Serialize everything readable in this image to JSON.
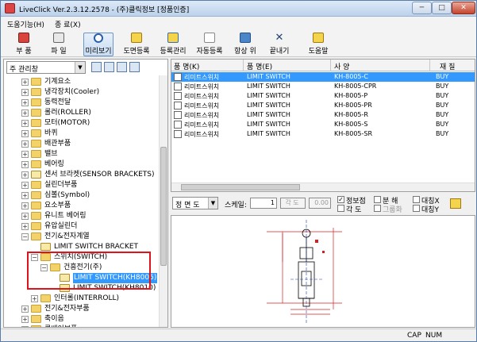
{
  "window": {
    "title": "LiveClick Ver.2.3.12.2578 - (주)클릭정보 [정품인증]",
    "min": "─",
    "max": "□",
    "close": "✕"
  },
  "menu": [
    "도움기능(H)",
    "종 료(X)"
  ],
  "toolbar": [
    {
      "label": "부 품",
      "icon": "parts-icon"
    },
    {
      "label": "파 일",
      "icon": "file-icon"
    },
    {
      "label": "미리보기",
      "icon": "preview-icon"
    },
    {
      "label": "도면등록",
      "icon": "drawing-register-icon"
    },
    {
      "label": "등록관리",
      "icon": "register-manage-icon"
    },
    {
      "label": "자동등록",
      "icon": "auto-register-icon"
    },
    {
      "label": "항상 위",
      "icon": "always-on-top-icon"
    },
    {
      "label": "끝내기",
      "icon": "exit-icon"
    },
    {
      "label": "도움말",
      "icon": "help-icon"
    }
  ],
  "left_panel": {
    "combo_value": "주 관리창",
    "combo_arrow": "▼",
    "tree": [
      {
        "label": "기계요소",
        "level": 1,
        "expander": "+"
      },
      {
        "label": "냉각장치(Cooler)",
        "level": 1,
        "expander": "+"
      },
      {
        "label": "동력전달",
        "level": 1,
        "expander": "+"
      },
      {
        "label": "롤러(ROLLER)",
        "level": 1,
        "expander": "+"
      },
      {
        "label": "모터(MOTOR)",
        "level": 1,
        "expander": "+"
      },
      {
        "label": "바퀴",
        "level": 1,
        "expander": "+"
      },
      {
        "label": "배관부품",
        "level": 1,
        "expander": "+"
      },
      {
        "label": "밸브",
        "level": 1,
        "expander": "+"
      },
      {
        "label": "베어링",
        "level": 1,
        "expander": "+"
      },
      {
        "label": "센서 브라켓(SENSOR BRACKETS)",
        "level": 1,
        "expander": "+"
      },
      {
        "label": "실린더부품",
        "level": 1,
        "expander": "+"
      },
      {
        "label": "심볼(Symbol)",
        "level": 1,
        "expander": "+"
      },
      {
        "label": "요소부품",
        "level": 1,
        "expander": "+"
      },
      {
        "label": "유니트 베어링",
        "level": 1,
        "expander": "+"
      },
      {
        "label": "유압실린더",
        "level": 1,
        "expander": "+"
      },
      {
        "label": "전기&전자계열",
        "level": 1,
        "expander": "−"
      },
      {
        "label": "LIMIT SWITCH BRACKET",
        "level": 2,
        "expander": ""
      },
      {
        "label": "스위치(SWITCH)",
        "level": 2,
        "expander": "−"
      },
      {
        "label": "건흥전기(주)",
        "level": 3,
        "expander": "−"
      },
      {
        "label": "LIMIT SWITCH(KH8005)",
        "level": 4,
        "expander": "",
        "selected": true
      },
      {
        "label": "LIMIT SWITCH(KH8010)",
        "level": 4,
        "expander": ""
      },
      {
        "label": "인터롤(INTERROLL)",
        "level": 2,
        "expander": "+"
      },
      {
        "label": "전기&전자부품",
        "level": 1,
        "expander": "+"
      },
      {
        "label": "축이음",
        "level": 1,
        "expander": "+"
      },
      {
        "label": "콘베이부품",
        "level": 1,
        "expander": "+"
      }
    ]
  },
  "grid": {
    "headers": [
      "품 명(K)",
      "품 명(E)",
      "사 양",
      "재 질"
    ],
    "rows": [
      {
        "name_k": "리미트스위치",
        "name_e": "LIMIT SWITCH",
        "spec": "KH-8005-C",
        "material": "BUY",
        "selected": true
      },
      {
        "name_k": "리미트스위치",
        "name_e": "LIMIT SWITCH",
        "spec": "KH-8005-CPR",
        "material": "BUY"
      },
      {
        "name_k": "리미트스위치",
        "name_e": "LIMIT SWITCH",
        "spec": "KH-8005-P",
        "material": "BUY"
      },
      {
        "name_k": "리미트스위치",
        "name_e": "LIMIT SWITCH",
        "spec": "KH-8005-PR",
        "material": "BUY"
      },
      {
        "name_k": "리미트스위치",
        "name_e": "LIMIT SWITCH",
        "spec": "KH-8005-R",
        "material": "BUY"
      },
      {
        "name_k": "리미트스위치",
        "name_e": "LIMIT SWITCH",
        "spec": "KH-8005-S",
        "material": "BUY"
      },
      {
        "name_k": "리미트스위치",
        "name_e": "LIMIT SWITCH",
        "spec": "KH-8005-SR",
        "material": "BUY"
      }
    ]
  },
  "options": {
    "view": "정 면 도",
    "view_arrow": "▼",
    "scale_label": "스케일:",
    "scale_value": "1",
    "angle_label": "각 도",
    "angle_value": "0.00",
    "basepoint_label": "정보점",
    "basepoint_checked": "✓",
    "angle_cb_label": "각  도",
    "split_label": "분  해",
    "grayscale_label": "그룹화",
    "mirror_x_label": "대칭X",
    "mirror_y_label": "대칭Y"
  },
  "status": {
    "cap": "CAP",
    "num": "NUM"
  }
}
